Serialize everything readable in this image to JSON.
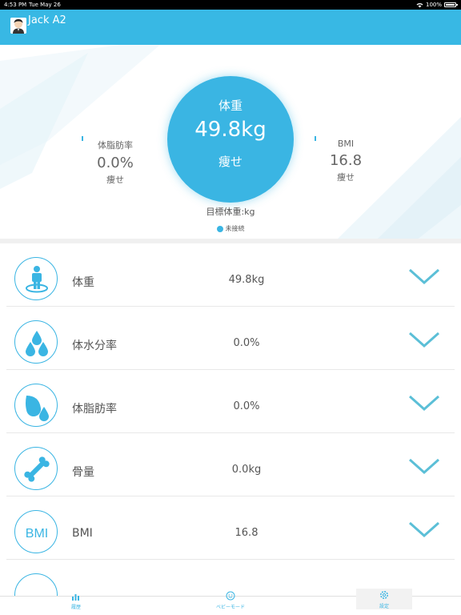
{
  "status_bar": {
    "time": "4:53 PM",
    "date": "Tue May 26",
    "battery": "100%"
  },
  "header": {
    "title": "Jack A2"
  },
  "summary": {
    "main": {
      "label": "体重",
      "value": "49.8kg",
      "status": "痩せ"
    },
    "left": {
      "label": "体脂肪率",
      "value": "0.0%",
      "status": "痩せ"
    },
    "right": {
      "label": "BMI",
      "value": "16.8",
      "status": "痩せ"
    },
    "target": "目標体重:kg",
    "connection": "未接続"
  },
  "metrics": [
    {
      "name": "体重",
      "value": "49.8kg",
      "icon": "person-scale-icon"
    },
    {
      "name": "体水分率",
      "value": "0.0%",
      "icon": "water-drops-icon"
    },
    {
      "name": "体脂肪率",
      "value": "0.0%",
      "icon": "fat-drops-icon"
    },
    {
      "name": "骨量",
      "value": "0.0kg",
      "icon": "bone-icon"
    },
    {
      "name": "BMI",
      "value": "16.8",
      "icon": "bmi-icon",
      "icon_text": "BMI"
    }
  ],
  "tabs": {
    "history": "履歴",
    "baby": "ベビーモード",
    "settings": "設定"
  },
  "colors": {
    "accent": "#38b8e4",
    "text": "#555555"
  }
}
